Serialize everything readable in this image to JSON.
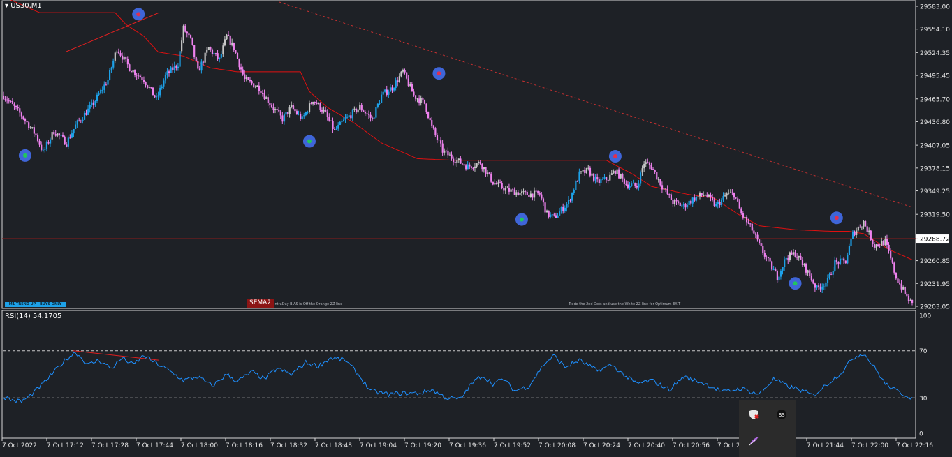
{
  "symbol_title": "US30,M1",
  "rsi_title": "RSI(14) 54.1705",
  "badges": {
    "trend": "M1 TREND UP - BUYS ONLY",
    "sema": "SEMA2",
    "note_left": "IntraDay BIAS is Off the Orange ZZ line -",
    "note_right": "Trade the 2nd Dots and use the White ZZ line for Optimum EXIT"
  },
  "colors": {
    "background": "#1e2126",
    "bull": "#1da1e8",
    "bear": "#ee82ee",
    "neutral": "#c8c8c8",
    "resistance_line": "#e01010",
    "rsi_line": "#1e90ff",
    "marker_blue": "#4169e1",
    "dot_green": "#22c55e",
    "dot_red": "#e03050"
  },
  "taskbar_icons": [
    "shield-icon",
    "bs-app-icon",
    "feather-icon"
  ],
  "chart_data": [
    {
      "type": "candlestick",
      "title": "US30,M1",
      "x": [
        "7 Oct 2022",
        "7 Oct 17:12",
        "7 Oct 17:28",
        "7 Oct 17:44",
        "7 Oct 18:00",
        "7 Oct 18:16",
        "7 Oct 18:32",
        "7 Oct 18:48",
        "7 Oct 19:04",
        "7 Oct 19:20",
        "7 Oct 19:36",
        "7 Oct 19:52",
        "7 Oct 20:08",
        "7 Oct 20:24",
        "7 Oct 20:40",
        "7 Oct 20:56",
        "7 Oct 21:",
        "7 Oct 21:44",
        "7 Oct 22:00",
        "7 Oct 22:16"
      ],
      "y_ticks": [
        "29583.00",
        "29554.10",
        "29524.35",
        "29495.45",
        "29465.70",
        "29436.80",
        "29407.05",
        "29378.15",
        "29349.25",
        "29319.50",
        "29288.72",
        "29260.85",
        "29231.95",
        "29203.05"
      ],
      "ylim": [
        29200,
        29590
      ],
      "current_price": 29288.72,
      "price_path": [
        [
          0,
          29470
        ],
        [
          10,
          29445
        ],
        [
          18,
          29420
        ],
        [
          22,
          29398
        ],
        [
          28,
          29425
        ],
        [
          35,
          29410
        ],
        [
          40,
          29432
        ],
        [
          50,
          29460
        ],
        [
          58,
          29490
        ],
        [
          63,
          29530
        ],
        [
          70,
          29505
        ],
        [
          78,
          29490
        ],
        [
          85,
          29465
        ],
        [
          90,
          29495
        ],
        [
          97,
          29510
        ],
        [
          100,
          29555
        ],
        [
          104,
          29540
        ],
        [
          108,
          29500
        ],
        [
          114,
          29530
        ],
        [
          120,
          29515
        ],
        [
          124,
          29545
        ],
        [
          128,
          29530
        ],
        [
          134,
          29490
        ],
        [
          142,
          29480
        ],
        [
          148,
          29460
        ],
        [
          155,
          29440
        ],
        [
          160,
          29455
        ],
        [
          166,
          29440
        ],
        [
          172,
          29465
        ],
        [
          178,
          29450
        ],
        [
          184,
          29425
        ],
        [
          190,
          29440
        ],
        [
          198,
          29455
        ],
        [
          205,
          29440
        ],
        [
          210,
          29470
        ],
        [
          216,
          29480
        ],
        [
          222,
          29500
        ],
        [
          228,
          29470
        ],
        [
          234,
          29460
        ],
        [
          238,
          29430
        ],
        [
          244,
          29400
        ],
        [
          250,
          29390
        ],
        [
          258,
          29380
        ],
        [
          265,
          29385
        ],
        [
          272,
          29360
        ],
        [
          280,
          29350
        ],
        [
          290,
          29345
        ],
        [
          298,
          29345
        ],
        [
          302,
          29320
        ],
        [
          306,
          29315
        ],
        [
          314,
          29335
        ],
        [
          320,
          29370
        ],
        [
          325,
          29375
        ],
        [
          330,
          29360
        ],
        [
          336,
          29365
        ],
        [
          340,
          29375
        ],
        [
          346,
          29358
        ],
        [
          352,
          29355
        ],
        [
          356,
          29385
        ],
        [
          360,
          29380
        ],
        [
          366,
          29355
        ],
        [
          372,
          29335
        ],
        [
          378,
          29330
        ],
        [
          384,
          29340
        ],
        [
          390,
          29345
        ],
        [
          396,
          29330
        ],
        [
          402,
          29345
        ],
        [
          406,
          29345
        ],
        [
          410,
          29320
        ],
        [
          416,
          29300
        ],
        [
          420,
          29280
        ],
        [
          425,
          29260
        ],
        [
          430,
          29240
        ],
        [
          435,
          29265
        ],
        [
          440,
          29270
        ],
        [
          446,
          29250
        ],
        [
          452,
          29225
        ],
        [
          458,
          29235
        ],
        [
          462,
          29258
        ],
        [
          468,
          29260
        ],
        [
          472,
          29295
        ],
        [
          478,
          29310
        ],
        [
          484,
          29280
        ],
        [
          490,
          29285
        ],
        [
          496,
          29240
        ],
        [
          502,
          29215
        ],
        [
          505,
          29205
        ]
      ],
      "resistance_path": [
        [
          0,
          29595
        ],
        [
          20,
          29575
        ],
        [
          40,
          29575
        ],
        [
          62,
          29575
        ],
        [
          68,
          29560
        ],
        [
          78,
          29545
        ],
        [
          86,
          29525
        ],
        [
          100,
          29520
        ],
        [
          115,
          29505
        ],
        [
          130,
          29500
        ],
        [
          156,
          29500
        ],
        [
          165,
          29500
        ],
        [
          170,
          29475
        ],
        [
          180,
          29455
        ],
        [
          195,
          29435
        ],
        [
          210,
          29410
        ],
        [
          220,
          29400
        ],
        [
          230,
          29390
        ],
        [
          250,
          29388
        ],
        [
          300,
          29388
        ],
        [
          320,
          29388
        ],
        [
          335,
          29388
        ],
        [
          350,
          29370
        ],
        [
          360,
          29355
        ],
        [
          380,
          29345
        ],
        [
          395,
          29340
        ],
        [
          408,
          29320
        ],
        [
          420,
          29305
        ],
        [
          440,
          29300
        ],
        [
          460,
          29298
        ],
        [
          470,
          29298
        ],
        [
          478,
          29295
        ],
        [
          485,
          29285
        ],
        [
          492,
          29275
        ],
        [
          505,
          29262
        ]
      ],
      "swing_highs": [
        [
          75,
          29573
        ],
        [
          242,
          29498
        ],
        [
          340,
          29393
        ],
        [
          463,
          29315
        ]
      ],
      "swing_lows": [
        [
          12,
          29394
        ],
        [
          170,
          29412
        ],
        [
          288,
          29313
        ],
        [
          440,
          29232
        ]
      ]
    },
    {
      "type": "line",
      "title": "RSI(14) 54.1705",
      "series": [
        {
          "values": [
            [
              0,
              31
            ],
            [
              5,
              28
            ],
            [
              10,
              27
            ],
            [
              15,
              32
            ],
            [
              22,
              42
            ],
            [
              28,
              52
            ],
            [
              35,
              63
            ],
            [
              40,
              69
            ],
            [
              47,
              58
            ],
            [
              53,
              62
            ],
            [
              60,
              55
            ],
            [
              66,
              64
            ],
            [
              72,
              58
            ],
            [
              78,
              66
            ],
            [
              84,
              60
            ],
            [
              90,
              55
            ],
            [
              100,
              45
            ],
            [
              108,
              48
            ],
            [
              116,
              40
            ],
            [
              124,
              50
            ],
            [
              130,
              44
            ],
            [
              138,
              52
            ],
            [
              145,
              46
            ],
            [
              152,
              55
            ],
            [
              160,
              50
            ],
            [
              168,
              60
            ],
            [
              175,
              57
            ],
            [
              182,
              64
            ],
            [
              190,
              62
            ],
            [
              196,
              52
            ],
            [
              204,
              36
            ],
            [
              214,
              33
            ],
            [
              222,
              34
            ],
            [
              232,
              34
            ],
            [
              238,
              37
            ],
            [
              246,
              30
            ],
            [
              254,
              29
            ],
            [
              260,
              42
            ],
            [
              266,
              49
            ],
            [
              272,
              42
            ],
            [
              278,
              46
            ],
            [
              284,
              36
            ],
            [
              292,
              40
            ],
            [
              300,
              58
            ],
            [
              306,
              66
            ],
            [
              312,
              56
            ],
            [
              320,
              62
            ],
            [
              330,
              53
            ],
            [
              338,
              58
            ],
            [
              346,
              48
            ],
            [
              352,
              42
            ],
            [
              360,
              45
            ],
            [
              370,
              37
            ],
            [
              378,
              48
            ],
            [
              390,
              42
            ],
            [
              400,
              35
            ],
            [
              410,
              38
            ],
            [
              420,
              33
            ],
            [
              428,
              46
            ],
            [
              436,
              40
            ],
            [
              444,
              36
            ],
            [
              450,
              32
            ],
            [
              458,
              42
            ],
            [
              466,
              52
            ],
            [
              472,
              64
            ],
            [
              478,
              68
            ],
            [
              484,
              56
            ],
            [
              490,
              42
            ],
            [
              496,
              36
            ],
            [
              502,
              32
            ],
            [
              505,
              30
            ]
          ]
        }
      ],
      "y_ticks": [
        "100",
        "70",
        "30",
        "0"
      ],
      "ylim": [
        0,
        100
      ],
      "levels": [
        70,
        30
      ],
      "current_value": 54.1705
    }
  ]
}
